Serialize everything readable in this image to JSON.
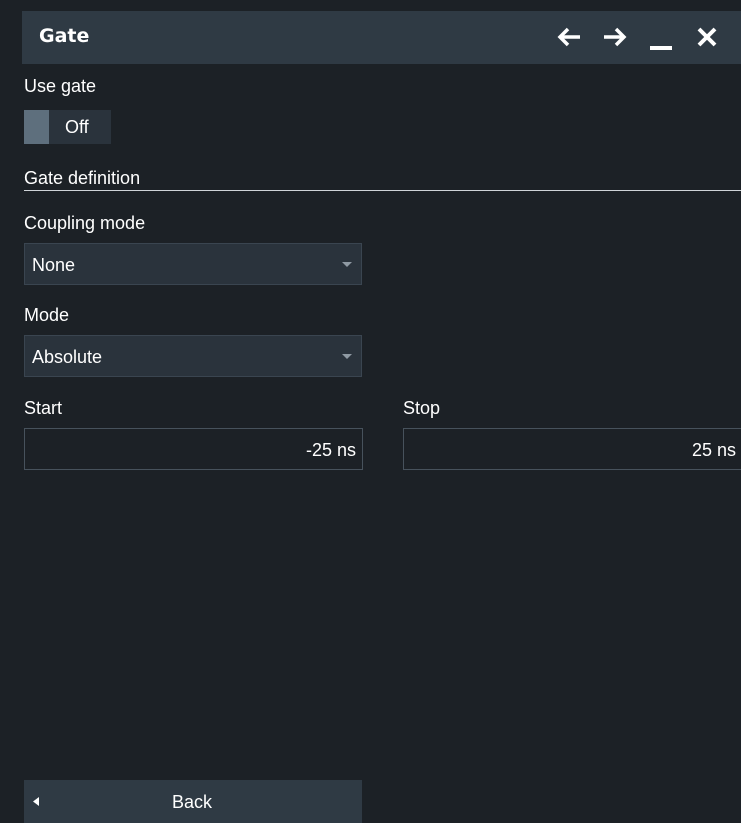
{
  "dialog": {
    "title": "Gate",
    "buttons": {
      "back_arrow": "arrow-left-icon",
      "forward_arrow": "arrow-right-icon",
      "minimize": "minimize-icon",
      "close": "close-icon"
    }
  },
  "use_gate": {
    "label": "Use gate",
    "state": "Off"
  },
  "gate_definition": {
    "section_label": "Gate definition",
    "coupling_mode": {
      "label": "Coupling mode",
      "value": "None"
    },
    "mode": {
      "label": "Mode",
      "value": "Absolute"
    },
    "start": {
      "label": "Start",
      "value": "-25 ns"
    },
    "stop": {
      "label": "Stop",
      "value": "25 ns"
    }
  },
  "footer": {
    "back_label": "Back"
  },
  "colors": {
    "background": "#1c2126",
    "titlebar": "#2f3a44",
    "field": "#2a333c",
    "toggle_knob": "#5e6f7d"
  }
}
